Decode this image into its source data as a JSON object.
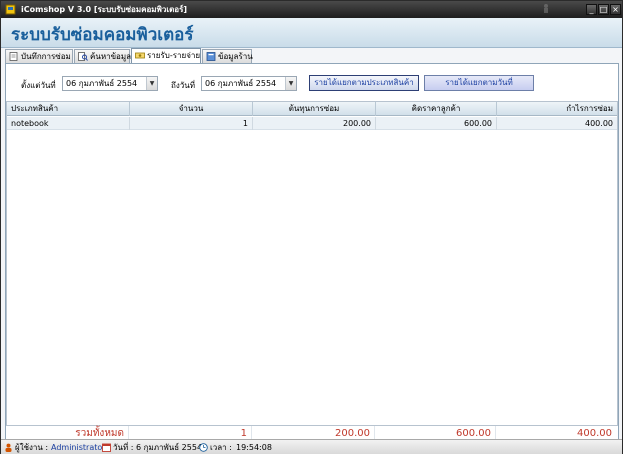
{
  "window": {
    "title": "iComshop V 3.0  [ระบบรับซ่อมคอมพิวเตอร์]",
    "controls": {
      "minimize": "_",
      "maximize": "□",
      "close": "×"
    }
  },
  "header": {
    "system_title": "ระบบรับซ่อมคอมพิวเตอร์"
  },
  "tabs": [
    {
      "label": "บันทึกการซ่อม",
      "icon": "notebook-icon"
    },
    {
      "label": "ค้นหาข้อมูล",
      "icon": "search-document-icon"
    },
    {
      "label": "รายรับ-รายจ่าย",
      "icon": "money-icon",
      "active": true
    },
    {
      "label": "ข้อมูลร้าน",
      "icon": "book-icon"
    }
  ],
  "filters": {
    "from_label": "ตั้งแต่วันที่",
    "from_date": "06  กุมภาพันธ์  2554",
    "to_label": "ถึงวันที่",
    "to_date": "06  กุมภาพันธ์  2554"
  },
  "buttons": {
    "by_category": "รายได้แยกตามประเภทสินค้า",
    "by_date": "รายได้แยกตามวันที่"
  },
  "table": {
    "columns": [
      "ประเภทสินค้า",
      "จำนวน",
      "ต้นทุนการซ่อม",
      "คิดราคาลูกค้า",
      "กำไรการซ่อม"
    ],
    "rows": [
      {
        "category": "notebook",
        "quantity": "1",
        "cost": "200.00",
        "price": "600.00",
        "profit": "400.00"
      }
    ]
  },
  "totals": {
    "label": "รวมทั้งหมด",
    "quantity": "1",
    "cost": "200.00",
    "price": "600.00",
    "profit": "400.00"
  },
  "status": {
    "user_label": "ผู้ใช้งาน :",
    "user": "Administrator",
    "date_label": "วันที่ :",
    "date": "6 กุมภาพันธ์ 2554",
    "time_label": "เวลา :",
    "time": "19:54:08"
  },
  "colors": {
    "title_blue": "#1a5f9c",
    "totals_red": "#c0392b",
    "link_blue": "#1a3ea0"
  }
}
